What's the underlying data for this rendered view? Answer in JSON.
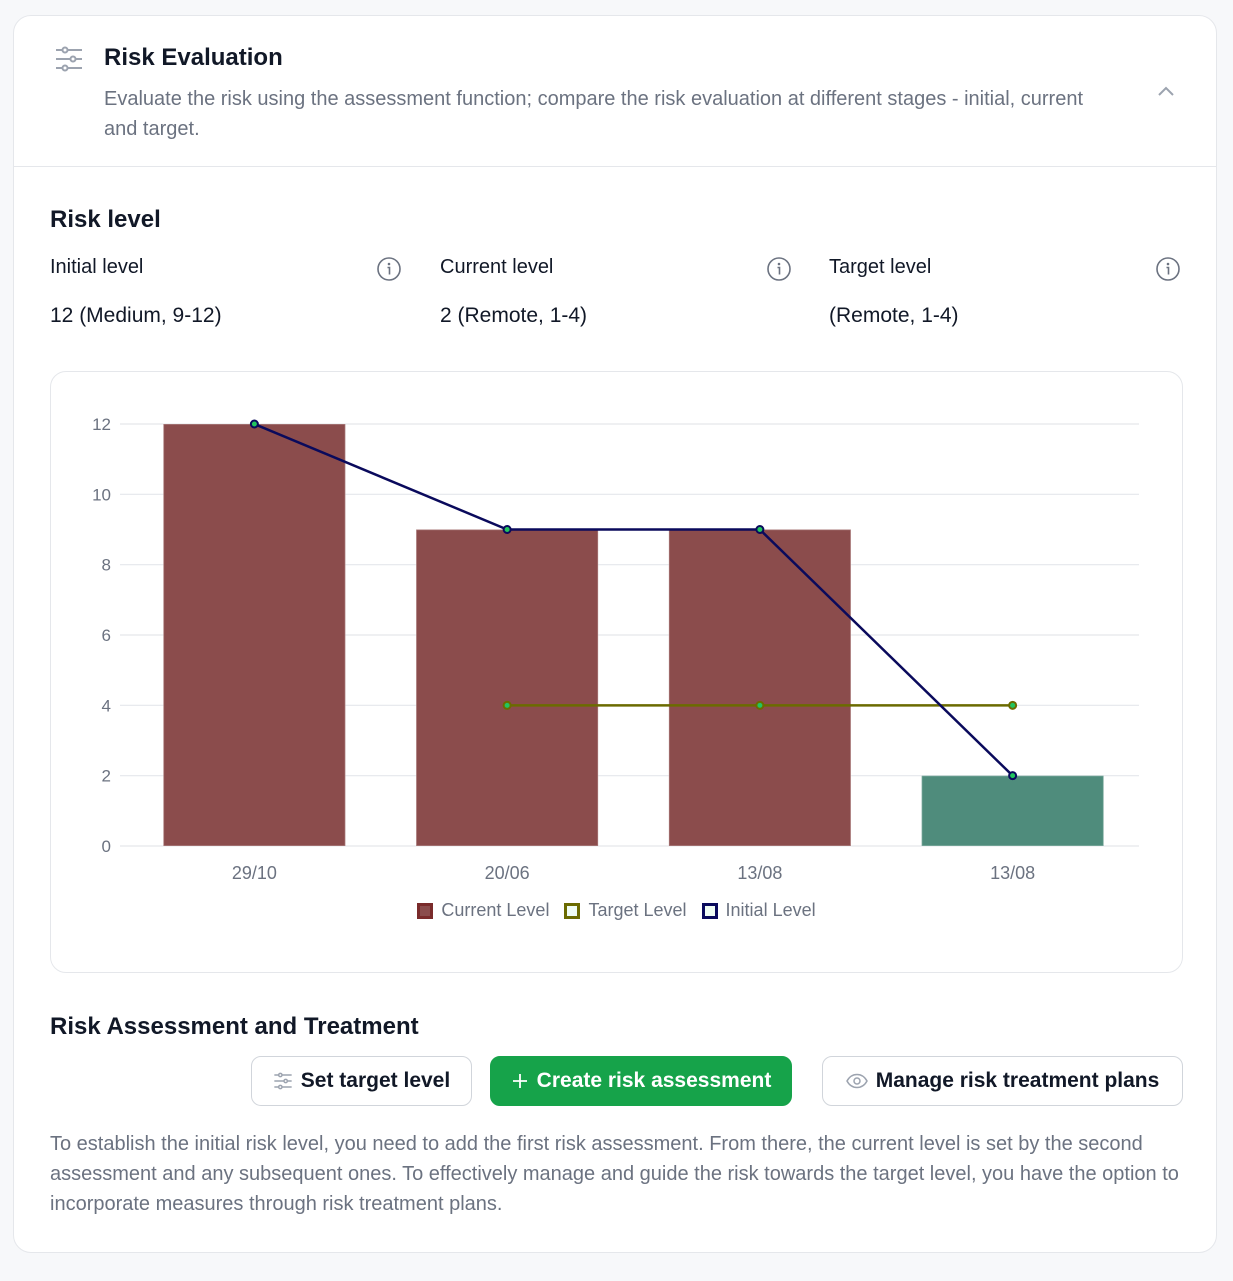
{
  "header": {
    "icon": "sliders-icon",
    "title": "Risk Evaluation",
    "description": "Evaluate the risk using the assessment function; compare the risk evaluation at different stages - initial, current and target.",
    "collapse_icon": "chevron-up-icon"
  },
  "risk_level": {
    "title": "Risk level",
    "levels": [
      {
        "label": "Initial level",
        "value": "12 (Medium, 9-12)",
        "icon": "info-icon"
      },
      {
        "label": "Current level",
        "value": "2 (Remote, 1-4)",
        "icon": "info-icon"
      },
      {
        "label": "Target level",
        "value": "(Remote, 1-4)",
        "icon": "info-icon"
      }
    ]
  },
  "chart_data": {
    "type": "bar",
    "title": "",
    "xlabel": "",
    "ylabel": "",
    "categories": [
      "29/10",
      "20/06",
      "13/08",
      "13/08"
    ],
    "ylim": [
      0,
      12
    ],
    "yticks": [
      0,
      2,
      4,
      6,
      8,
      10,
      12
    ],
    "grid": true,
    "legend_position": "bottom",
    "series": [
      {
        "name": "Current Level",
        "type": "bar",
        "values": [
          12,
          9,
          9,
          2
        ],
        "colors": [
          "#8b4c4c",
          "#8b4c4c",
          "#8b4c4c",
          "#4f8c7c"
        ],
        "legend_color": "#7a2b2b"
      },
      {
        "name": "Target Level",
        "type": "line",
        "values": [
          null,
          4,
          4,
          4
        ],
        "color": "#6b6b00"
      },
      {
        "name": "Initial Level",
        "type": "line",
        "values": [
          12,
          9,
          9,
          2
        ],
        "color": "#0a0a5c"
      }
    ]
  },
  "assessment": {
    "title": "Risk Assessment and Treatment",
    "buttons": {
      "set_target": {
        "label": "Set target level",
        "icon": "sliders-icon"
      },
      "create": {
        "label": "Create risk assessment",
        "icon": "plus-icon"
      },
      "manage": {
        "label": "Manage risk treatment plans",
        "icon": "eye-icon"
      }
    },
    "description": "To establish the initial risk level, you need to add the first risk assessment. From there, the current level is set by the second assessment and any subsequent ones. To effectively manage and guide the risk towards the target level, you have the option to incorporate measures through risk treatment plans."
  },
  "colors": {
    "primary": "#16a34a",
    "bar_high": "#8b4c4c",
    "bar_low": "#4f8c7c",
    "target_line": "#6b6b00",
    "initial_line": "#0a0a5c"
  }
}
